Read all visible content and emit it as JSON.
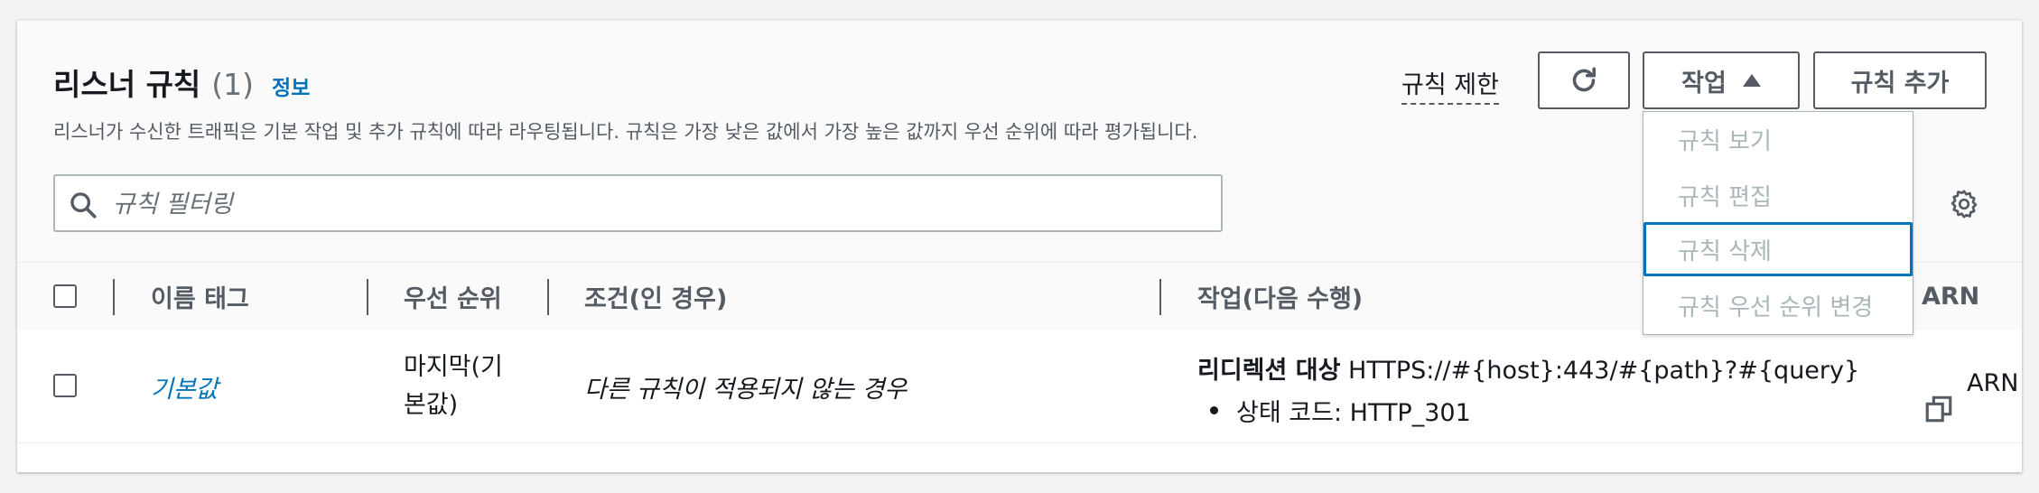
{
  "header": {
    "title": "리스너 규칙",
    "count": "(1)",
    "info_link": "정보",
    "description": "리스너가 수신한 트래픽은 기본 작업 및 추가 규칙에 따라 라우팅됩니다. 규칙은 가장 낮은 값에서 가장 높은 값까지 우선 순위에 따라 평가됩니다."
  },
  "toolbar": {
    "rule_limit": "규칙 제한",
    "refresh_icon": "refresh-icon",
    "actions_label": "작업",
    "add_rule_label": "규칙 추가"
  },
  "actions_menu": {
    "items": [
      "규칙 보기",
      "규칙 편집",
      "규칙 삭제",
      "규칙 우선 순위 변경"
    ],
    "focused_index": 2
  },
  "search": {
    "placeholder": "규칙 필터링",
    "value": ""
  },
  "table": {
    "columns": [
      "이름 태그",
      "우선 순위",
      "조건(인 경우)",
      "작업(다음 수행)",
      "ARN"
    ],
    "rows": [
      {
        "name": "기본값",
        "priority_line1": "마지막(기",
        "priority_line2": "본값)",
        "condition": "다른 규칙이 적용되지 않는 경우",
        "action_label": "리디렉션 대상",
        "action_target": "HTTPS://#{host}:443/#{path}?#{query}",
        "status_code": "상태 코드: HTTP_301",
        "arn": "ARN"
      }
    ]
  },
  "colors": {
    "link": "#0073bb",
    "text": "#16191f",
    "muted": "#545b64",
    "disabled": "#aab7b8",
    "background": "#f2f3f3"
  }
}
